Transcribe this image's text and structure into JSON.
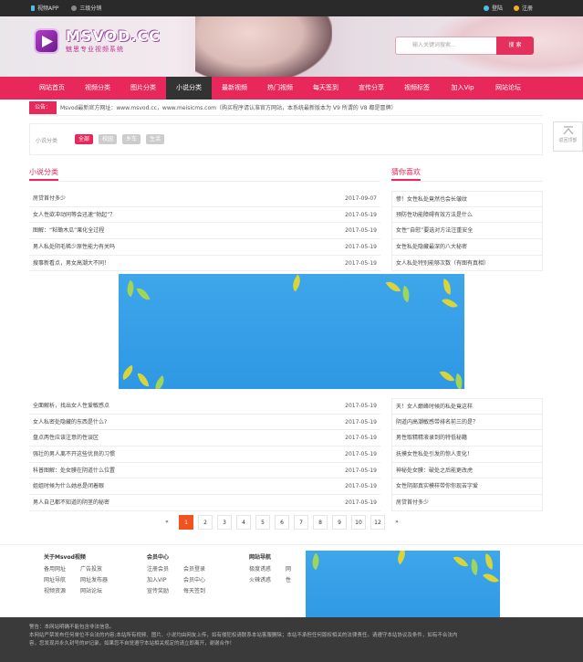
{
  "topbar": {
    "app_label": "视频APP",
    "fenxiao_label": "三级分销",
    "login_label": "登陆",
    "register_label": "注册"
  },
  "header": {
    "logo_text": "MSVOD.CC",
    "logo_subtitle": "魅思专业视频系统",
    "search_placeholder": "输入关键词搜索...",
    "search_button": "搜 索"
  },
  "nav": {
    "items": [
      "网站首页",
      "视频分类",
      "图片分类",
      "小说分类",
      "最新视频",
      "热门视频",
      "每天签到",
      "宣传分享",
      "视频标签",
      "加入Vip",
      "网站论坛"
    ],
    "active_index": 3
  },
  "notice": {
    "tag": "公告：",
    "text": "Msvod最新官方网址：www.msvod.cc，www.meisicms.com（购买程序请认准官方网站，本系统最新版本为 V9  所谓的 V8 都是冒牌）"
  },
  "float_label": "返回顶部",
  "filter": {
    "label": "小说分类",
    "chips": [
      "全部",
      "校园",
      "乡车",
      "生活"
    ],
    "active_index": 0
  },
  "sections": {
    "left_title": "小说分类",
    "right_title": "猜你喜欢"
  },
  "left_list_top": [
    {
      "title": "房贷首付多少",
      "date": "2017-09-07"
    },
    {
      "title": "女人性欲冲动同等会迅速“勃起”？",
      "date": "2017-05-19"
    },
    {
      "title": "图解：“粘锄木瓜”果化全过程",
      "date": "2017-05-19"
    },
    {
      "title": "男人私处阴毛稀少原性能力有关吗",
      "date": "2017-05-19"
    },
    {
      "title": "搜事新看点，男女高潮大不同！",
      "date": "2017-05-19"
    }
  ],
  "right_list_top": [
    "惨！女性私处竟然也会长皱纹",
    "预防性功能障碍有效方法是什么",
    "女性“自慰”要选对方法注重安全",
    "女性私处隐藏最深的八大秘密",
    "女人私处特别能够次数（有图有真相）"
  ],
  "left_list_bottom": [
    {
      "title": "全面解析，找出女人性爱敏感点",
      "date": "2017-05-19"
    },
    {
      "title": "女人私密处隐藏的东西是什么?",
      "date": "2017-05-19"
    },
    {
      "title": "盘点两性应该注意的性误区",
      "date": "2017-05-19"
    },
    {
      "title": "强壮的男人离不开这些优良的习惯",
      "date": "2017-05-19"
    },
    {
      "title": "科普图解：处女膜在阴道什么位置",
      "date": "2017-05-19"
    },
    {
      "title": "姐姐时候为什么她总是闭着眼",
      "date": "2017-05-19"
    },
    {
      "title": "男人自己都不知道的阴茎的秘密",
      "date": "2017-05-19"
    }
  ],
  "right_list_bottom": [
    "天！女人巅峰时候的私处竟这样",
    "阴道内高潮敏感带排名前三的是？",
    "男性取精精液录到的特低秘籍",
    "抚摸女性私处引发的惊人变化！",
    "神秘处女膜：破处之后能更改虎",
    "女性阴部真实模样带你你现苦字爱",
    "房贷首付多少"
  ],
  "pager": [
    "«",
    "1",
    "2",
    "3",
    "4",
    "5",
    "6",
    "7",
    "8",
    "9",
    "10",
    "12",
    "»"
  ],
  "pager_active": 1,
  "footer_cols": [
    {
      "title": "关于Msvod视频",
      "links": [
        "备用网址",
        "广告投放",
        "网址导航",
        "网址发布器",
        "视频资源",
        "网站论坛"
      ]
    },
    {
      "title": "会员中心",
      "links": [
        "注册会员",
        "会员登录",
        "加入VIP",
        "会员中心",
        "宣传奖励",
        "每天签到"
      ]
    },
    {
      "title": "网站导航",
      "links": [
        "极度诱惑",
        "网",
        "火辣诱惑",
        "性"
      ]
    }
  ],
  "footer_text": [
    "警告：本网站明确不能包含非法信息。",
    "本网站严禁发布任何单位不合法的内容;本站所有视频、图片、小说均由网友上传，如有侵犯权请联系本站客服删除；本站不承担任何版权相关的法律责任。请遵守本站协议及条件，如有不合法内",
    "容，您发现并永久封号的IP记录，如果您不自觉遵守本站相关规定的请立即离开，谢谢合作！"
  ],
  "colors": {
    "accent": "#e8285a",
    "nav_active": "#333333",
    "page_active": "#f2521e",
    "banner": "#2e98e4"
  }
}
